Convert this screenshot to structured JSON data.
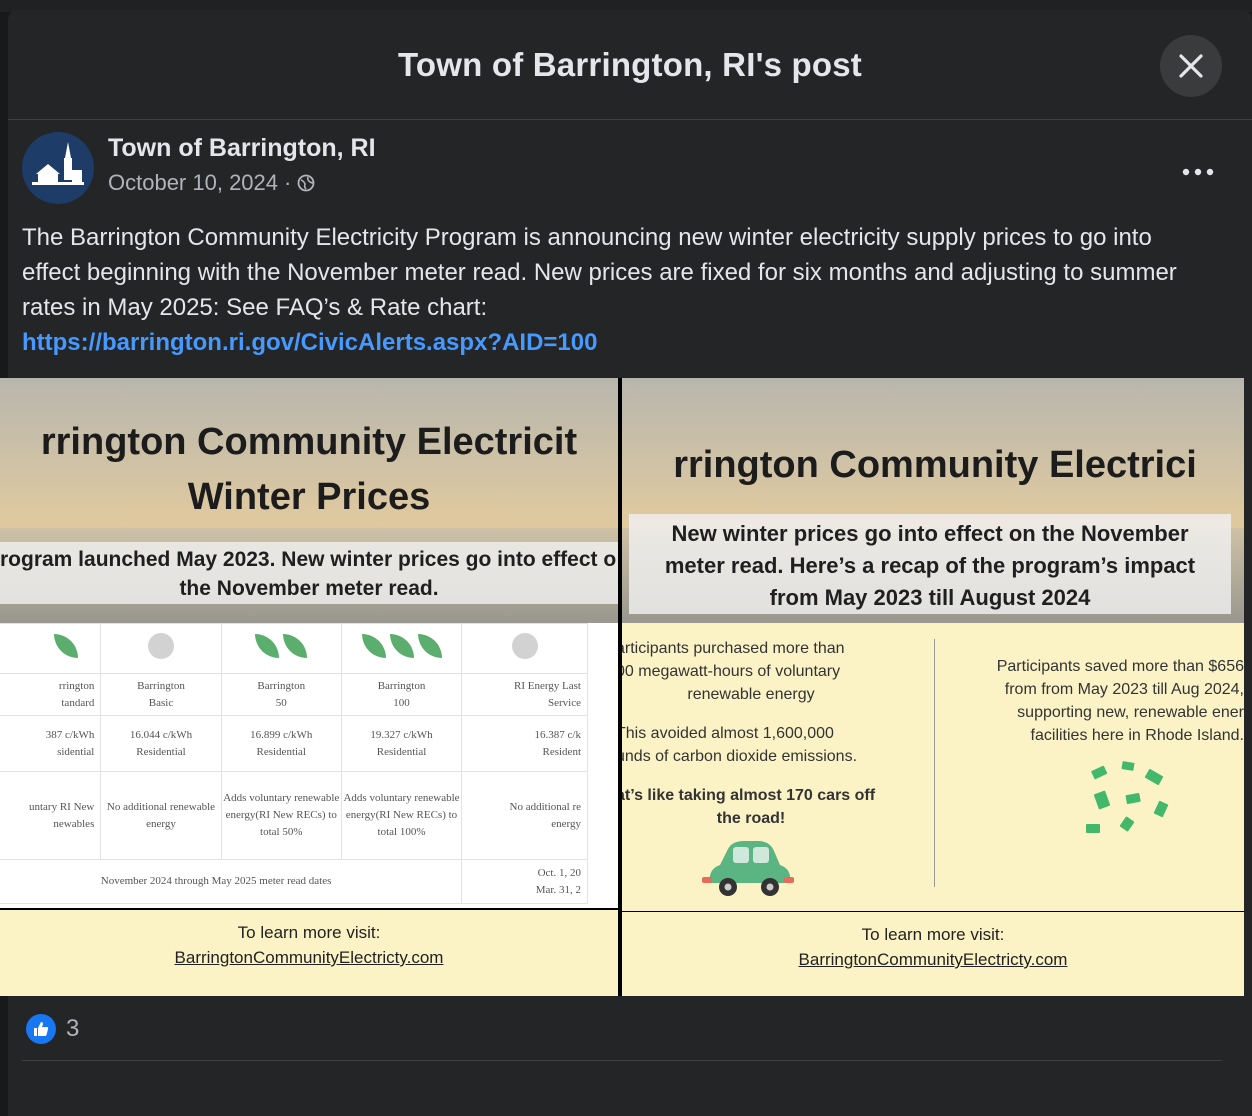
{
  "modal": {
    "title": "Town of Barrington, RI's post"
  },
  "post": {
    "author": "Town of Barrington, RI",
    "date": "October 10, 2024",
    "separator": "·",
    "text": "The Barrington Community Electricity Program is announcing new winter electricity supply prices to go into effect beginning with the November meter read. New prices are fixed for six months and adjusting to summer rates in May 2025: See FAQ’s & Rate chart:",
    "link": "https://barrington.ri.gov/CivicAlerts.aspx?AID=100",
    "reaction_count": "3"
  },
  "image_left": {
    "title_line1": "rrington Community Electricit",
    "title_line2": "Winter Prices",
    "sub_line1": "rogram launched May 2023. New winter prices go into effect o",
    "sub_line2": "the November meter read.",
    "columns": [
      {
        "name": "rrington",
        "sub": "tandard",
        "price": "387 c/kWh",
        "cls": "sidential",
        "desc": "untary RI New newables"
      },
      {
        "name": "Barrington",
        "sub": "Basic",
        "price": "16.044 c/kWh",
        "cls": "Residential",
        "desc": "No additional renewable energy"
      },
      {
        "name": "Barrington",
        "sub": "50",
        "price": "16.899 c/kWh",
        "cls": "Residential",
        "desc": "Adds voluntary renewable energy(RI New RECs) to total 50%"
      },
      {
        "name": "Barrington",
        "sub": "100",
        "price": "19.327 c/kWh",
        "cls": "Residential",
        "desc": "Adds voluntary renewable energy(RI New RECs) to total 100%"
      },
      {
        "name": "RI Energy Last",
        "sub": "Service",
        "price": "16.387 c/k",
        "cls": "Resident",
        "desc": "No additional re energy"
      }
    ],
    "dates_row": "November 2024 through May 2025 meter read dates",
    "dates_right_1": "Oct. 1, 20",
    "dates_right_2": "Mar. 31, 2",
    "learn_label": "To learn more visit:",
    "learn_url": "BarringtonCommunityElectricty.com"
  },
  "image_right": {
    "title": "rrington Community Electrici",
    "sub_line1": "New winter prices go into effect on the November",
    "sub_line2": "meter read. Here’s a recap of the program’s impact",
    "sub_line3": "from May 2023 till August 2024",
    "left_p1_l1": "articipants purchased more than",
    "left_p1_l2": "00 megawatt-hours of voluntary",
    "left_p1_l3": "renewable energy",
    "left_p2_l1": "This avoided almost 1,600,000",
    "left_p2_l2": "unds of carbon dioxide emissions.",
    "left_p3_l1": "at’s like taking almost 170 cars off",
    "left_p3_l2": "the road!",
    "right_p_l1": "Participants saved more than $656",
    "right_p_l2": "from from May 2023 till Aug 2024,",
    "right_p_l3": "supporting new, renewable ener",
    "right_p_l4": "facilities here in Rhode Island.",
    "learn_label": "To learn more visit:",
    "learn_url": "BarringtonCommunityElectricty.com"
  },
  "icons": {
    "close": "close-icon",
    "more": "more-options-icon",
    "globe": "globe-icon",
    "like": "like-icon"
  },
  "colors": {
    "link": "#4599ff",
    "like": "#1877f2",
    "panel": "#242526"
  }
}
